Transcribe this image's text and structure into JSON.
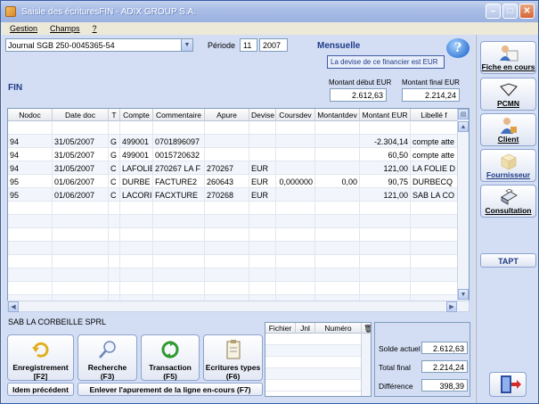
{
  "window": {
    "title": "Saisie des écrituresFIN   -   ADIX GROUP S.A.",
    "buttons": [
      "minimize",
      "maximize",
      "close"
    ]
  },
  "menu": [
    "Gestion",
    "Champs",
    "?"
  ],
  "header": {
    "journal": "Journal SGB 250-0045365-54",
    "periode_label": "Période",
    "periode_month": "11",
    "periode_year": "2007",
    "mode": "Mensuelle",
    "devise_msg": "La devise de ce financier est EUR",
    "section": "FIN",
    "montant_debut_label": "Montant début EUR",
    "montant_debut": "2.612,63",
    "montant_final_label": "Montant final EUR",
    "montant_final": "2.214,24"
  },
  "grid": {
    "columns": [
      "Nodoc",
      "Date doc",
      "T",
      "Compte",
      "Commentaire",
      "Apure",
      "Devise",
      "Coursdev",
      "Montantdev",
      "Montant EUR",
      "Libellé f"
    ],
    "rows": [
      [
        "",
        "",
        "",
        "",
        "",
        "",
        "",
        "",
        "",
        "",
        ""
      ],
      [
        "94",
        "31/05/2007",
        "G",
        "499001",
        "0701896097",
        "",
        "",
        "",
        "",
        "-2.304,14",
        "compte atte"
      ],
      [
        "94",
        "31/05/2007",
        "G",
        "499001",
        "0015720632",
        "",
        "",
        "",
        "",
        "60,50",
        "compte atte"
      ],
      [
        "94",
        "31/05/2007",
        "C",
        "LAFOLIE",
        "270267 LA F",
        "270267",
        "EUR",
        "",
        "",
        "121,00",
        "LA FOLIE D"
      ],
      [
        "95",
        "01/06/2007",
        "C",
        "DURBE",
        "FACTURE2",
        "260643",
        "EUR",
        "0,000000",
        "0,00",
        "90,75",
        "DURBECQ"
      ],
      [
        "95",
        "01/06/2007",
        "C",
        "LACORI",
        "FACXTURE",
        "270268",
        "EUR",
        "",
        "",
        "121,00",
        "SAB LA CO"
      ]
    ]
  },
  "footer": {
    "company": "SAB LA CORBEILLE SPRL",
    "actions": [
      {
        "label": "Enregistrement",
        "key": "[F2]",
        "icon": "refresh-arrow-icon"
      },
      {
        "label": "Recherche",
        "key": "(F3)",
        "icon": "magnifier-icon"
      },
      {
        "label": "Transaction",
        "key": "(F5)",
        "icon": "green-cycle-icon"
      },
      {
        "label": "Ecritures types",
        "key": "(F6)",
        "icon": "clipboard-icon"
      }
    ],
    "idem": "Idem précédent",
    "enlever": "Enlever l'apurement de la ligne en-cours (F7)",
    "fichier_columns": [
      "Fichier",
      "Jnl",
      "Numéro"
    ],
    "solde_actuel_label": "Solde actuel",
    "solde_actuel": "2.612,63",
    "total_final_label": "Total final",
    "total_final": "2.214,24",
    "difference_label": "Différence",
    "difference": "398,39"
  },
  "sidebar": {
    "items": [
      {
        "label": "Fiche en cours",
        "icon": "user-card-icon"
      },
      {
        "label": "PCMN",
        "icon": "book-icon"
      },
      {
        "label": "Client",
        "icon": "client-icon"
      },
      {
        "label": "Fournisseur",
        "icon": "box-icon"
      },
      {
        "label": "Consultation",
        "icon": "printer-icon"
      }
    ],
    "tapt": "TAPT"
  },
  "colors": {
    "accent": "#1f3b85",
    "panel": "#d3def5",
    "title_bar": "#a9bde6"
  }
}
